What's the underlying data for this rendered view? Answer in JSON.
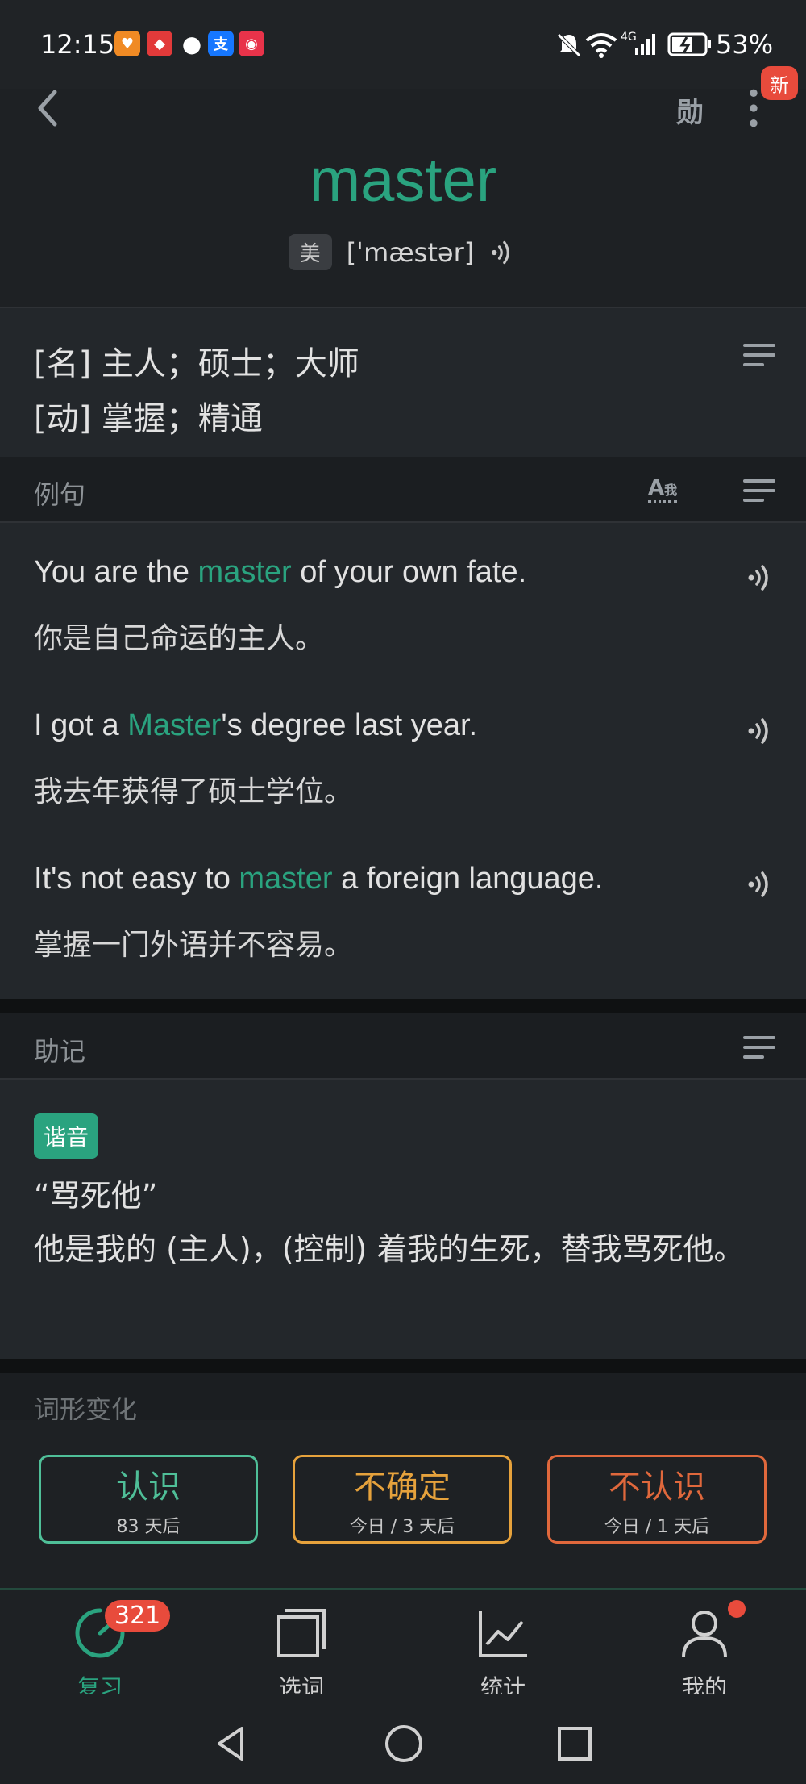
{
  "status": {
    "time": "12:15",
    "network": "4G",
    "battery": "53%"
  },
  "header": {
    "new_badge": "新",
    "word": "master",
    "accent_tag": "美",
    "phonetic": "[ˈmæstər]"
  },
  "definitions": [
    "[名] 主人；硕士；大师",
    "[动] 掌握；精通"
  ],
  "examples": {
    "title": "例句",
    "items": [
      {
        "before": "You are the ",
        "keyword": "master",
        "after": " of your own fate.",
        "zh": "你是自己命运的主人。"
      },
      {
        "before": "I got a ",
        "keyword": "Master",
        "after": "'s degree last year.",
        "zh": "我去年获得了硕士学位。"
      },
      {
        "before": "It's not easy to ",
        "keyword": "master",
        "after": " a foreign language.",
        "zh": "掌握一门外语并不容易。"
      }
    ]
  },
  "mnemonic": {
    "title": "助记",
    "tag": "谐音",
    "quote": "“骂死他”",
    "text": "他是我的 (主人)，(控制) 着我的生死，替我骂死他。"
  },
  "word_forms": {
    "title": "词形变化"
  },
  "actions": [
    {
      "label": "认识",
      "sub": "83 天后",
      "color": "#4fbf98"
    },
    {
      "label": "不确定",
      "sub": "今日 / 3 天后",
      "color": "#e6a23c"
    },
    {
      "label": "不认识",
      "sub": "今日 / 1 天后",
      "color": "#e0683c"
    }
  ],
  "tabs": [
    {
      "label": "复习",
      "icon": "review-icon",
      "badge": "321",
      "active": true
    },
    {
      "label": "选词",
      "icon": "pick-words-icon"
    },
    {
      "label": "统计",
      "icon": "stats-icon"
    },
    {
      "label": "我的",
      "icon": "profile-icon"
    }
  ],
  "colors": {
    "accent": "#2aa37f",
    "badge": "#e84b3c"
  }
}
